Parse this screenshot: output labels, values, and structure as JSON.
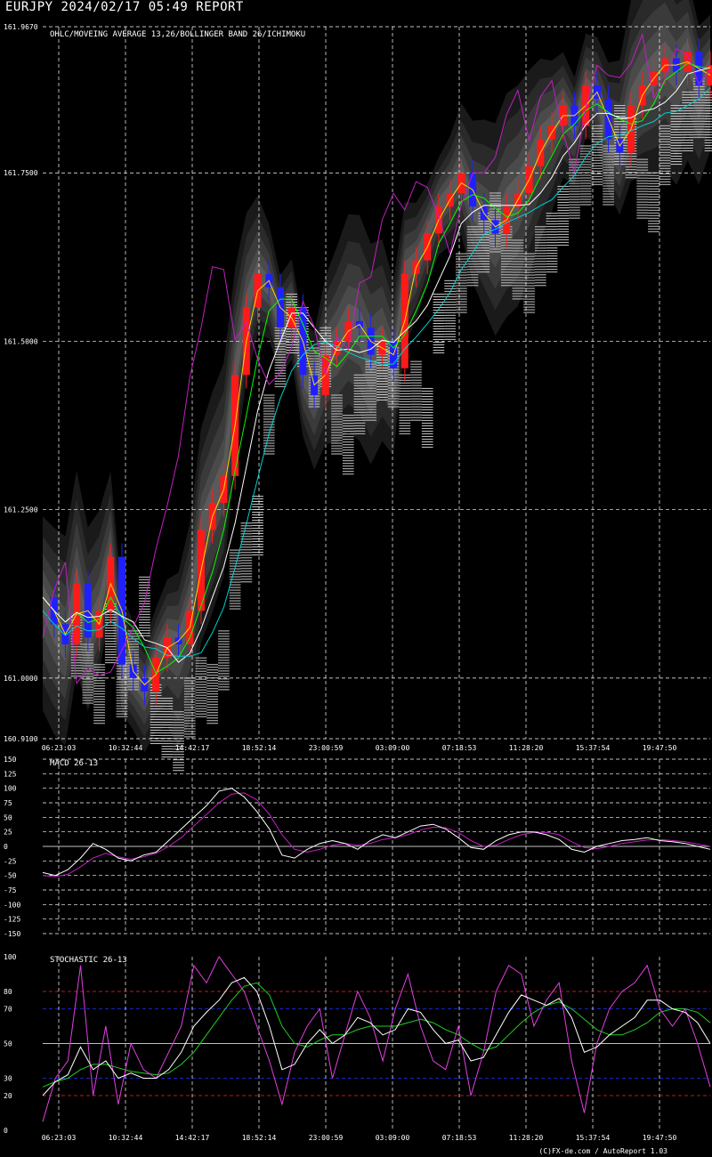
{
  "report_title": "EURJPY 2024/02/17 05:49 REPORT",
  "footer": "(C)FX-de.com / AutoReport 1.03",
  "colors": {
    "background": "#000000",
    "up_candle": "#ff1a1a",
    "down_candle": "#2020ff",
    "sma_short": "#ffd700",
    "sma_long": "#00ff00",
    "bollinger_mid": "#ffffff",
    "ichimoku_kijun": "#00d0d0",
    "chikou": "#c020c0",
    "grid": "#ffffff",
    "stoch_k": "#e040e0",
    "stoch_d": "#ffffff",
    "stoch_slow": "#20d020",
    "overbought": "#ff2020",
    "level70_30": "#2030ff"
  },
  "chart_data": [
    {
      "type": "line",
      "name": "price",
      "title": "OHLC/MOVEING AVERAGE 13,26/BOLLINGER BAND 26/ICHIMOKU",
      "ylim": [
        160.91,
        161.967
      ],
      "yticks": [
        "161.9670",
        "161.7500",
        "161.5000",
        "161.2500",
        "161.0000",
        "160.9100"
      ],
      "ytick_values": [
        161.967,
        161.75,
        161.5,
        161.25,
        161.0,
        160.91
      ],
      "xticks": [
        "06:23:03",
        "10:32:44",
        "14:42:17",
        "18:52:14",
        "23:00:59",
        "03:09:00",
        "07:18:53",
        "11:28:20",
        "15:37:54",
        "19:47:50"
      ],
      "close_series": [
        161.12,
        161.08,
        161.05,
        161.14,
        161.06,
        161.1,
        161.18,
        161.02,
        161.0,
        160.98,
        161.03,
        161.06,
        161.05,
        161.1,
        161.22,
        161.26,
        161.3,
        161.45,
        161.55,
        161.6,
        161.58,
        161.52,
        161.55,
        161.45,
        161.42,
        161.48,
        161.5,
        161.53,
        161.52,
        161.48,
        161.5,
        161.46,
        161.6,
        161.62,
        161.66,
        161.7,
        161.72,
        161.75,
        161.7,
        161.68,
        161.66,
        161.7,
        161.72,
        161.76,
        161.8,
        161.82,
        161.85,
        161.82,
        161.88,
        161.86,
        161.8,
        161.78,
        161.85,
        161.88,
        161.9,
        161.92,
        161.9,
        161.93,
        161.88,
        161.91
      ],
      "grid": true
    },
    {
      "type": "line",
      "name": "macd",
      "title": "MACD 26-13",
      "ylim": [
        -150,
        150
      ],
      "yticks": [
        "150",
        "125",
        "100",
        "75",
        "50",
        "25",
        "0",
        "-25",
        "-50",
        "-75",
        "-100",
        "-125",
        "-150"
      ],
      "ytick_values": [
        150,
        125,
        100,
        75,
        50,
        25,
        0,
        -25,
        -50,
        -75,
        -100,
        -125,
        -150
      ],
      "macd": [
        -45,
        -50,
        -40,
        -20,
        5,
        -5,
        -20,
        -25,
        -15,
        -10,
        10,
        30,
        50,
        70,
        95,
        100,
        85,
        60,
        30,
        -15,
        -20,
        -5,
        5,
        10,
        5,
        -5,
        10,
        20,
        15,
        25,
        35,
        38,
        30,
        15,
        -2,
        -5,
        10,
        20,
        25,
        25,
        20,
        12,
        -5,
        -10,
        0,
        5,
        10,
        12,
        15,
        10,
        8,
        5,
        0,
        -5
      ],
      "signal": [
        -50,
        -52,
        -48,
        -35,
        -20,
        -12,
        -18,
        -22,
        -18,
        -12,
        0,
        15,
        35,
        55,
        75,
        90,
        92,
        80,
        55,
        20,
        -5,
        -10,
        -5,
        2,
        5,
        2,
        5,
        12,
        15,
        20,
        28,
        33,
        32,
        24,
        10,
        0,
        2,
        12,
        20,
        24,
        24,
        20,
        8,
        -2,
        -4,
        0,
        5,
        8,
        11,
        12,
        10,
        8,
        4,
        0
      ],
      "grid": true
    },
    {
      "type": "line",
      "name": "stochastic",
      "title": "STOCHASTIC 26-13",
      "ylim": [
        0,
        100
      ],
      "yticks": [
        "100",
        "80",
        "70",
        "50",
        "30",
        "20",
        "0"
      ],
      "ytick_values": [
        100,
        80,
        70,
        50,
        30,
        20,
        0
      ],
      "xticks": [
        "06:23:03",
        "10:32:44",
        "14:42:17",
        "18:52:14",
        "23:00:59",
        "03:09:00",
        "07:18:53",
        "11:28:20",
        "15:37:54",
        "19:47:50"
      ],
      "k": [
        5,
        30,
        40,
        95,
        20,
        60,
        15,
        50,
        35,
        30,
        45,
        60,
        95,
        85,
        100,
        90,
        80,
        60,
        40,
        15,
        45,
        60,
        70,
        30,
        55,
        80,
        65,
        40,
        70,
        90,
        60,
        40,
        35,
        60,
        20,
        45,
        80,
        95,
        90,
        60,
        75,
        85,
        40,
        10,
        50,
        70,
        80,
        85,
        95,
        70,
        60,
        70,
        50,
        25
      ],
      "d": [
        20,
        28,
        32,
        48,
        35,
        40,
        30,
        33,
        30,
        30,
        35,
        45,
        60,
        68,
        75,
        85,
        88,
        80,
        60,
        35,
        38,
        50,
        58,
        50,
        55,
        65,
        62,
        55,
        58,
        70,
        68,
        58,
        50,
        52,
        40,
        42,
        55,
        68,
        78,
        75,
        72,
        76,
        65,
        45,
        48,
        55,
        60,
        65,
        75,
        75,
        70,
        68,
        62,
        50
      ],
      "slow": [
        25,
        28,
        30,
        35,
        38,
        38,
        36,
        34,
        33,
        32,
        33,
        38,
        45,
        55,
        65,
        75,
        83,
        85,
        78,
        60,
        50,
        48,
        52,
        55,
        55,
        58,
        60,
        60,
        60,
        62,
        64,
        62,
        58,
        55,
        50,
        46,
        48,
        55,
        62,
        68,
        72,
        74,
        70,
        64,
        58,
        55,
        55,
        58,
        62,
        68,
        70,
        70,
        68,
        62
      ],
      "levels": [
        80,
        70,
        50,
        30,
        20
      ],
      "grid": true
    }
  ]
}
